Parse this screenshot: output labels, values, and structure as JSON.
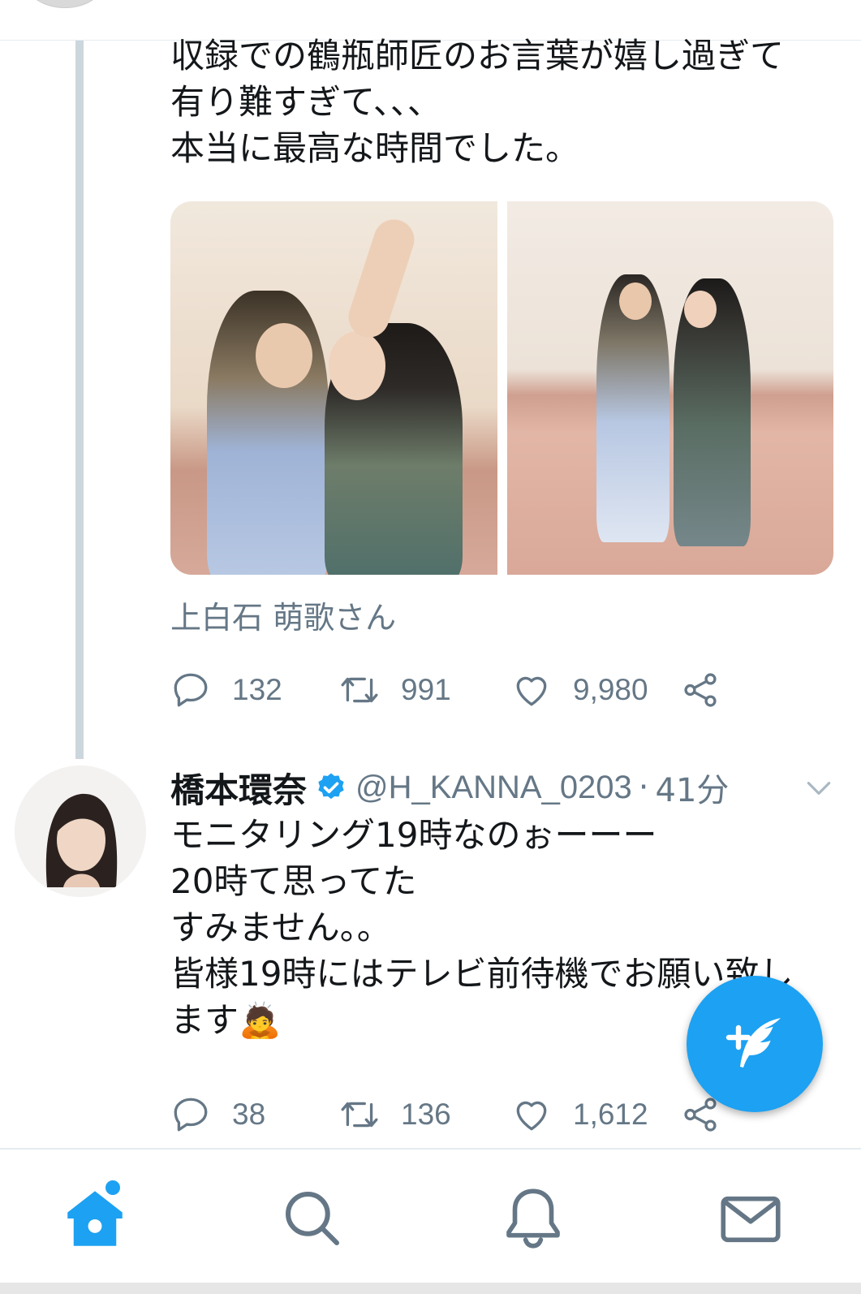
{
  "tweet1": {
    "text": "収録での鶴瓶師匠のお言葉が嬉し過ぎて\n有り難すぎて、、、\n本当に最高な時間でした。",
    "caption": "上白石 萌歌さん",
    "replies": "132",
    "retweets": "991",
    "likes": "9,980"
  },
  "tweet2": {
    "name": "橋本環奈",
    "handle": "@H_KANNA_0203",
    "separator": "·",
    "time": "41分",
    "text": "モニタリング19時なのぉーーー\n20時て思ってた\nすみません。。\n皆様19時にはテレビ前待機でお願い致し\nます🙇",
    "replies": "38",
    "retweets": "136",
    "likes": "1,612"
  },
  "icons": {
    "reply": "reply-icon",
    "retweet": "retweet-icon",
    "like": "heart-icon",
    "share": "share-icon",
    "verified": "verified-badge-icon",
    "chevron": "chevron-down-icon",
    "compose": "compose-tweet-icon",
    "home": "home-icon",
    "search": "search-icon",
    "notifications": "bell-icon",
    "messages": "mail-icon"
  },
  "colors": {
    "accent": "#1da1f2",
    "secondary_text": "#657786",
    "primary_text": "#14171a",
    "thread_line": "#ccd6dd"
  }
}
